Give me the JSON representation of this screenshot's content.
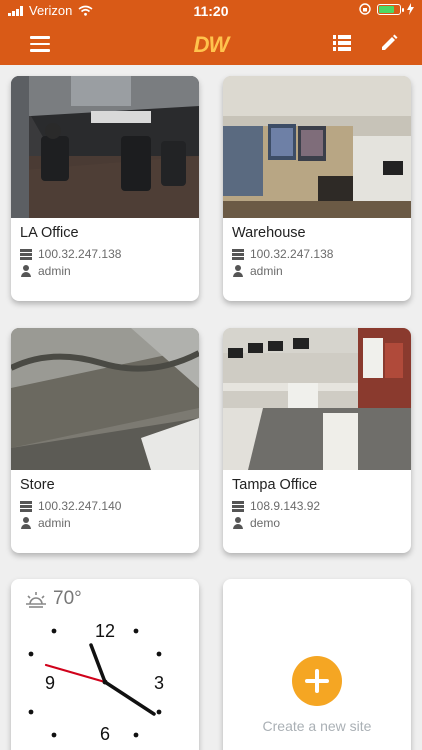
{
  "status_bar": {
    "carrier": "Verizon",
    "time": "11:20"
  },
  "app_bar": {
    "logo": "DW"
  },
  "sites": [
    {
      "name": "LA Office",
      "ip": "100.32.247.138",
      "user": "admin"
    },
    {
      "name": "Warehouse",
      "ip": "100.32.247.138",
      "user": "admin"
    },
    {
      "name": "Store",
      "ip": "100.32.247.140",
      "user": "admin"
    },
    {
      "name": "Tampa Office",
      "ip": "108.9.143.92",
      "user": "demo"
    }
  ],
  "widget": {
    "temperature": "70°",
    "clock_numbers": [
      "12",
      "3",
      "6",
      "9"
    ]
  },
  "add_site": {
    "label": "Create a new site"
  },
  "colors": {
    "accent": "#d95a17",
    "logo": "#ffc34d",
    "add_button": "#f5a623"
  }
}
